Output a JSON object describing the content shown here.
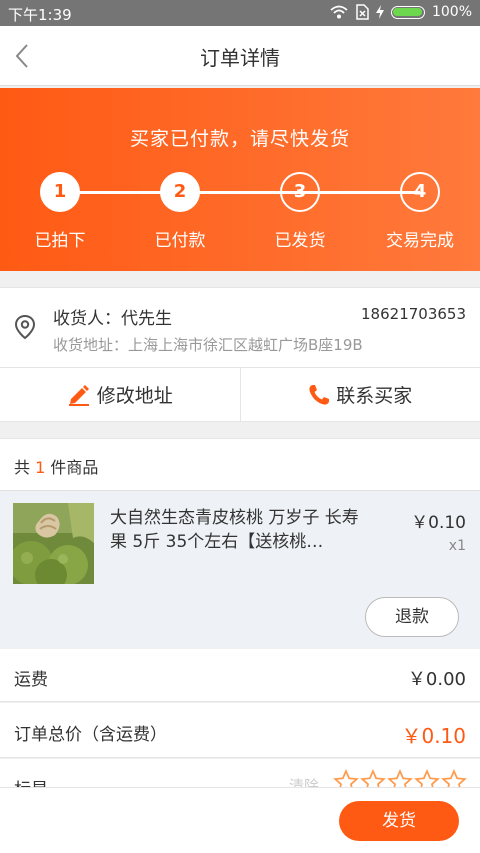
{
  "status_bar": {
    "time": "下午1:39",
    "battery": "100%",
    "battery_level": 1.0
  },
  "nav": {
    "title": "订单详情",
    "back_icon": "chevron-left-icon"
  },
  "banner": {
    "message": "买家已付款，请尽快发货",
    "steps": [
      {
        "num": "1",
        "label": "已拍下",
        "done": true
      },
      {
        "num": "2",
        "label": "已付款",
        "done": true
      },
      {
        "num": "3",
        "label": "已发货",
        "done": false
      },
      {
        "num": "4",
        "label": "交易完成",
        "done": false
      }
    ]
  },
  "address": {
    "receiver": "收货人：代先生",
    "phone": "18621703653",
    "address": "收货地址：上海上海市徐汇区越虹广场B座19B"
  },
  "actions": {
    "edit_address": "修改地址",
    "contact_buyer": "联系买家"
  },
  "goods": {
    "header_prefix": "共",
    "count": "1",
    "header_suffix": "件商品",
    "items": [
      {
        "name": "大自然生态青皮核桃 万岁子 长寿果 5斤 35个左右【送核桃…",
        "price": "￥0.10",
        "qty": "x1",
        "refund_label": "退款"
      }
    ]
  },
  "fees": {
    "freight_label": "运费",
    "freight_value": "￥0.00",
    "total_label": "订单总价（含运费）",
    "total_value": "￥0.10"
  },
  "mark": {
    "label": "标星",
    "clear": "清除",
    "stars": 0,
    "max_stars": 5
  },
  "footer": {
    "ship_label": "发货"
  },
  "colors": {
    "accent": "#ff5a14",
    "status_bar": "#757575",
    "battery": "#6dd84d"
  }
}
